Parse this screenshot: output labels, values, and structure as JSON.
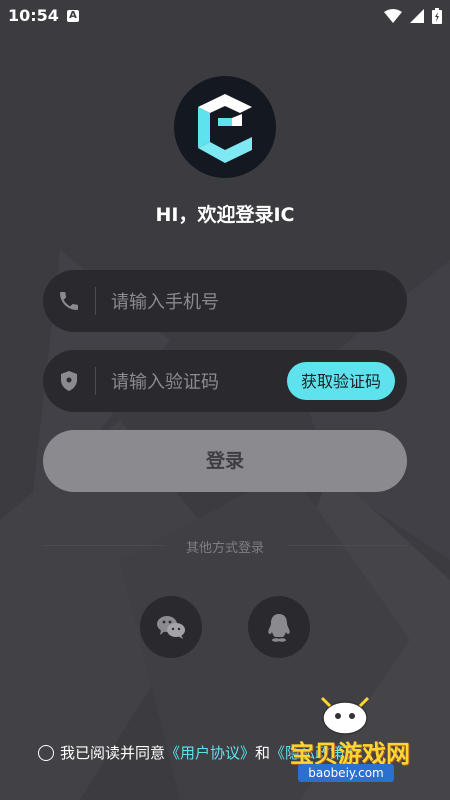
{
  "status_bar": {
    "time": "10:54",
    "notification_badge": "A"
  },
  "welcome_text": "HI，欢迎登录IC",
  "phone_field": {
    "placeholder": "请输入手机号",
    "icon": "phone-icon"
  },
  "code_field": {
    "placeholder": "请输入验证码",
    "icon": "shield-icon",
    "get_code_label": "获取验证码"
  },
  "login_button": {
    "label": "登录"
  },
  "other_login": {
    "label": "其他方式登录",
    "options": [
      "wechat-icon",
      "qq-icon"
    ]
  },
  "agreement": {
    "prefix": "我已阅读并同意",
    "link1": "《用户协议》",
    "connector": "和",
    "link2": "《隐私政策》"
  },
  "watermark": {
    "title": "宝贝游戏网",
    "url": "baobeiy.com"
  },
  "colors": {
    "background": "#3b3b40",
    "field": "#2a2a2e",
    "accent": "#5ee3ee",
    "login_button": "#8b8b8f"
  }
}
